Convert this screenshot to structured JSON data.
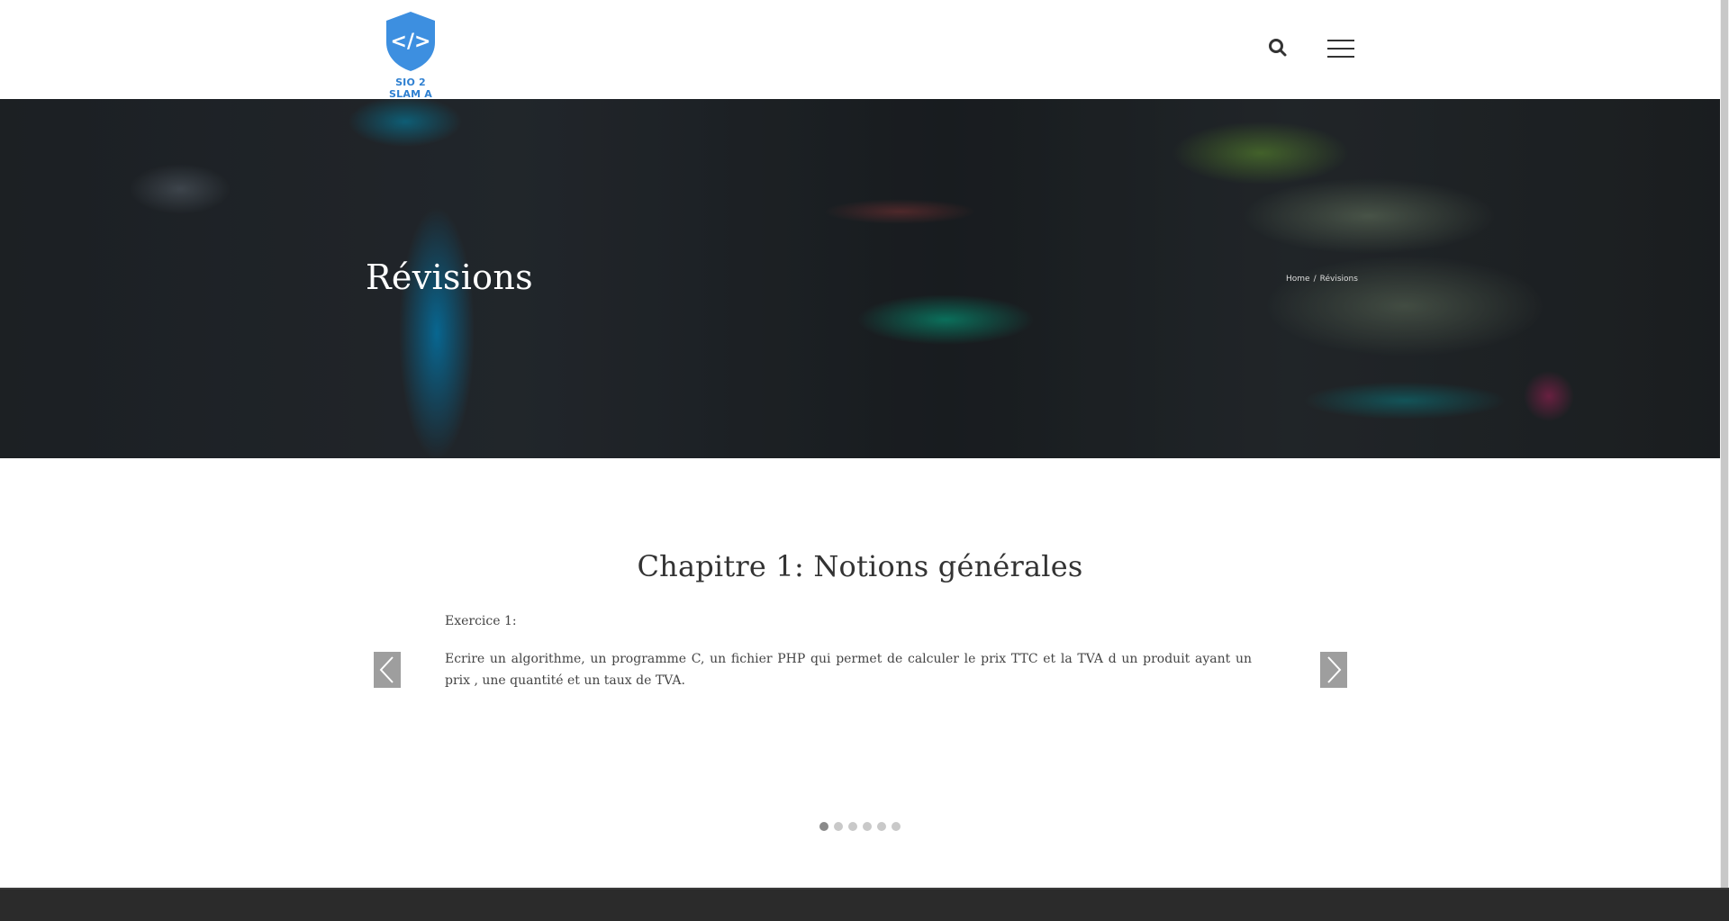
{
  "header": {
    "logo_text": "SIO 2 SLAM A",
    "logo_symbol": "</>",
    "icons": {
      "search": "search-icon",
      "menu": "menu-icon"
    }
  },
  "hero": {
    "title": "Révisions",
    "breadcrumb": {
      "home": "Home",
      "separator": "/",
      "current": "Révisions"
    }
  },
  "content": {
    "section_title": "Chapitre 1: Notions générales",
    "exercise_label": "Exercice 1:",
    "exercise_text": "Ecrire un algorithme, un programme C, un fichier PHP qui permet de calculer le prix TTC et la TVA d un produit ayant un prix , une quantité et un taux de TVA."
  },
  "slider": {
    "prev_icon": "chevron-left-icon",
    "next_icon": "chevron-right-icon",
    "dots_total": 6,
    "active_dot": 1
  },
  "colors": {
    "brand": "#3d8fe0",
    "text": "#333333",
    "footer": "#2b2b2b"
  }
}
